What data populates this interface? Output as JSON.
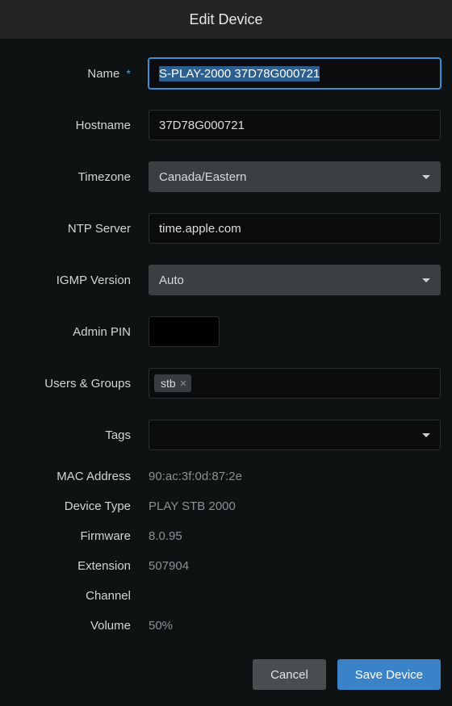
{
  "header": {
    "title": "Edit Device"
  },
  "fields": {
    "name": {
      "label": "Name",
      "value": "S-PLAY-2000 37D78G000721",
      "required": "*"
    },
    "hostname": {
      "label": "Hostname",
      "value": "37D78G000721"
    },
    "timezone": {
      "label": "Timezone",
      "value": "Canada/Eastern"
    },
    "ntp_server": {
      "label": "NTP Server",
      "value": "time.apple.com"
    },
    "igmp_version": {
      "label": "IGMP Version",
      "value": "Auto"
    },
    "admin_pin": {
      "label": "Admin PIN",
      "value": ""
    },
    "users_groups": {
      "label": "Users & Groups",
      "tags": [
        "stb"
      ]
    },
    "tags": {
      "label": "Tags",
      "value": ""
    }
  },
  "info": {
    "mac_address": {
      "label": "MAC Address",
      "value": "90:ac:3f:0d:87:2e"
    },
    "device_type": {
      "label": "Device Type",
      "value": "PLAY STB 2000"
    },
    "firmware": {
      "label": "Firmware",
      "value": "8.0.95"
    },
    "extension": {
      "label": "Extension",
      "value": "507904"
    },
    "channel": {
      "label": "Channel",
      "value": ""
    },
    "volume": {
      "label": "Volume",
      "value": "50%"
    }
  },
  "footer": {
    "cancel": "Cancel",
    "save": "Save Device"
  }
}
